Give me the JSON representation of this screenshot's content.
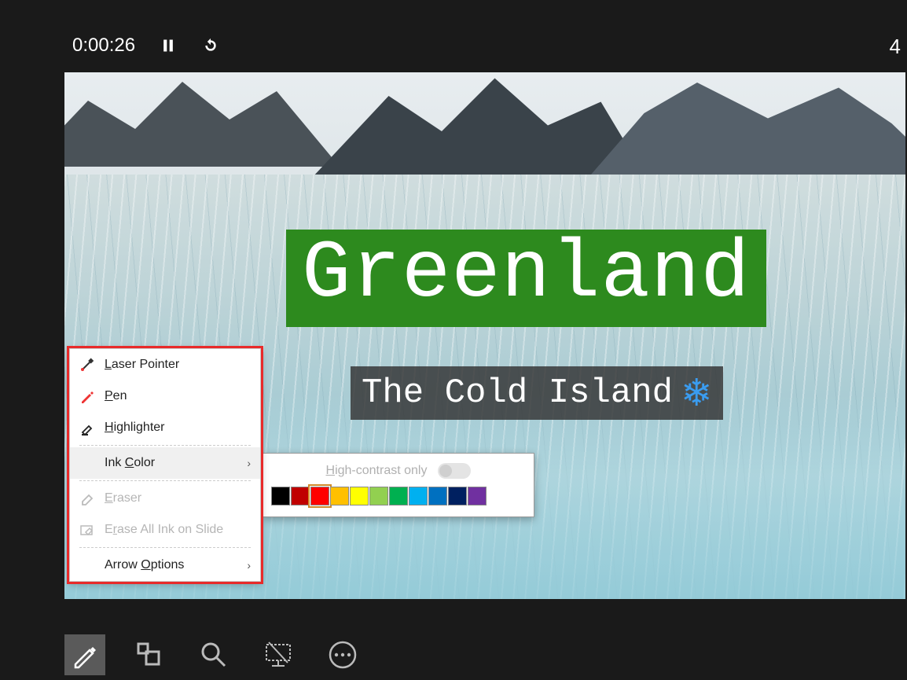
{
  "topbar": {
    "timer": "0:00:26",
    "right_label": "4"
  },
  "slide": {
    "title": "Greenland",
    "subtitle": "The Cold Island",
    "subtitle_icon": "snowflake",
    "title_bg": "#2d8a1e"
  },
  "context_menu": {
    "items": [
      {
        "icon": "laser-pointer",
        "label": "Laser Pointer",
        "underline_index": 0,
        "disabled": false,
        "submenu": false
      },
      {
        "icon": "pen-red",
        "label": "Pen",
        "underline_index": 0,
        "disabled": false,
        "submenu": false
      },
      {
        "icon": "highlighter",
        "label": "Highlighter",
        "underline_index": 0,
        "disabled": false,
        "submenu": false
      },
      {
        "icon": "",
        "label": "Ink Color",
        "underline_index": 4,
        "disabled": false,
        "submenu": true,
        "selected": true
      },
      {
        "icon": "eraser",
        "label": "Eraser",
        "underline_index": 0,
        "disabled": true,
        "submenu": false
      },
      {
        "icon": "erase-all",
        "label": "Erase All Ink on Slide",
        "underline_index": 1,
        "disabled": true,
        "submenu": false
      },
      {
        "icon": "",
        "label": "Arrow Options",
        "underline_index": 6,
        "disabled": false,
        "submenu": true
      }
    ]
  },
  "color_submenu": {
    "high_contrast_label": "High-contrast only",
    "high_contrast_on": false,
    "colors": [
      "#000000",
      "#c00000",
      "#ff0000",
      "#ffc000",
      "#ffff00",
      "#92d050",
      "#00b050",
      "#00b0f0",
      "#0070c0",
      "#002060",
      "#7030a0"
    ],
    "selected_index": 2
  },
  "bottom_bar": {
    "buttons": [
      {
        "name": "pen-tool",
        "active": true
      },
      {
        "name": "see-all-slides",
        "active": false
      },
      {
        "name": "zoom",
        "active": false
      },
      {
        "name": "black-screen",
        "active": false
      },
      {
        "name": "more-options",
        "active": false
      }
    ]
  }
}
